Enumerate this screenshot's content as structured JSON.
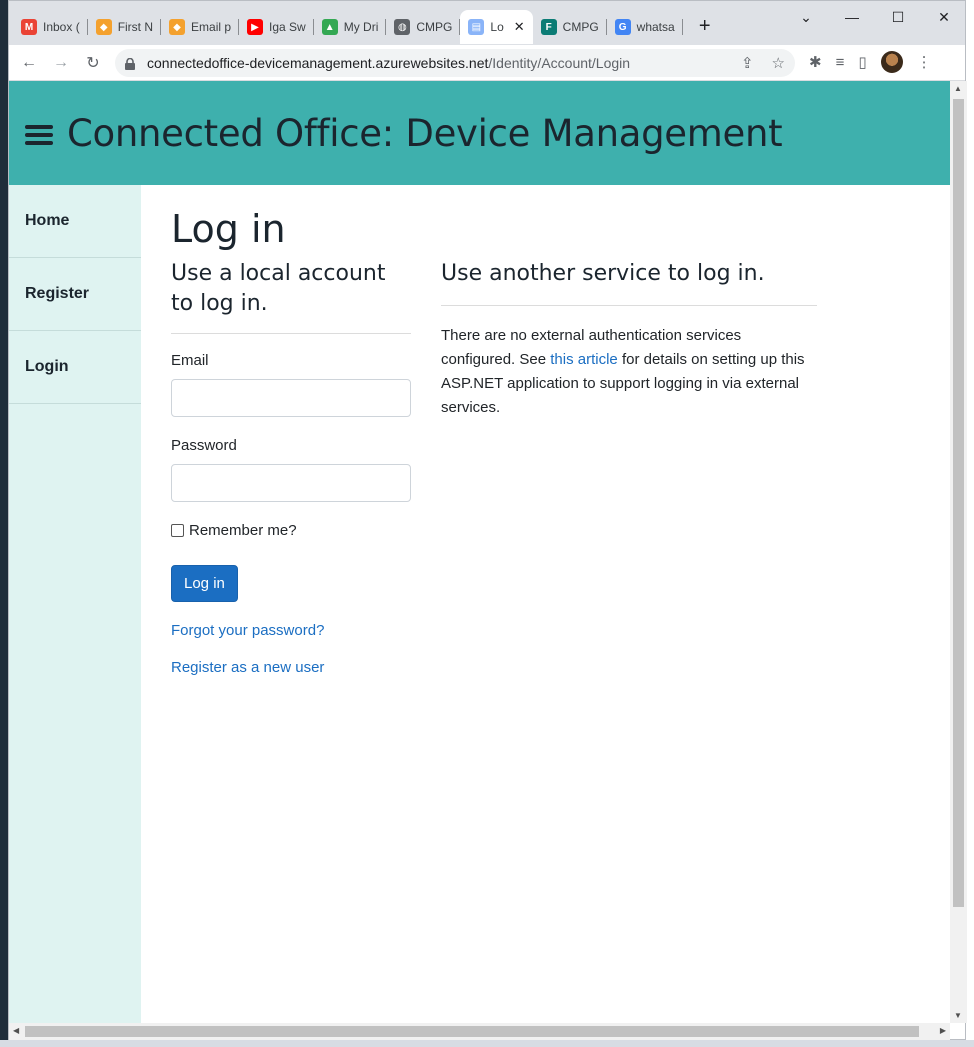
{
  "browser": {
    "tabs": [
      {
        "label": "Inbox (",
        "icon": "gmail-icon",
        "color": "#ea4335",
        "glyph": "M"
      },
      {
        "label": "First N",
        "icon": "hexagon-icon",
        "color": "#f4a12e",
        "glyph": "◆"
      },
      {
        "label": "Email p",
        "icon": "hexagon-icon",
        "color": "#f4a12e",
        "glyph": "◆"
      },
      {
        "label": "Iga Sw",
        "icon": "youtube-icon",
        "color": "#ff0000",
        "glyph": "▶"
      },
      {
        "label": "My Dri",
        "icon": "drive-icon",
        "color": "#34a853",
        "glyph": "▲"
      },
      {
        "label": "CMPG",
        "icon": "globe-icon",
        "color": "#5f6368",
        "glyph": "◍"
      },
      {
        "label": "Lo",
        "icon": "document-icon",
        "color": "#8ab4f8",
        "glyph": "▤",
        "active": true
      },
      {
        "label": "CMPG",
        "icon": "forms-icon",
        "color": "#0b7c75",
        "glyph": "F"
      },
      {
        "label": "whatsa",
        "icon": "google-icon",
        "color": "#4285f4",
        "glyph": "G"
      }
    ],
    "new_tab": "+",
    "url_host": "connectedoffice-devicemanagement.azurewebsites.net",
    "url_path": "/Identity/Account/Login",
    "window_controls": {
      "dropdown": "⌄",
      "minimize": "—",
      "maximize": "☐",
      "close": "✕"
    },
    "nav": {
      "back": "←",
      "forward": "→",
      "reload": "↻"
    }
  },
  "site": {
    "title": "Connected Office: Device Management",
    "header_color": "#3eb0ad",
    "sidebar": {
      "items": [
        {
          "label": "Home"
        },
        {
          "label": "Register"
        },
        {
          "label": "Login"
        }
      ]
    }
  },
  "login": {
    "page_title": "Log in",
    "local_heading": "Use a local account to log in.",
    "email_label": "Email",
    "email_value": "",
    "password_label": "Password",
    "password_value": "",
    "remember_label": "Remember me?",
    "remember_checked": false,
    "submit_label": "Log in",
    "forgot_link": "Forgot your password?",
    "register_link": "Register as a new user",
    "external_heading": "Use another service to log in.",
    "external_text_before": "There are no external authentication services configured. See ",
    "external_link": "this article",
    "external_text_after": " for details on setting up this ASP.NET application to support logging in via external services.",
    "accent_color": "#1b6ec2"
  }
}
